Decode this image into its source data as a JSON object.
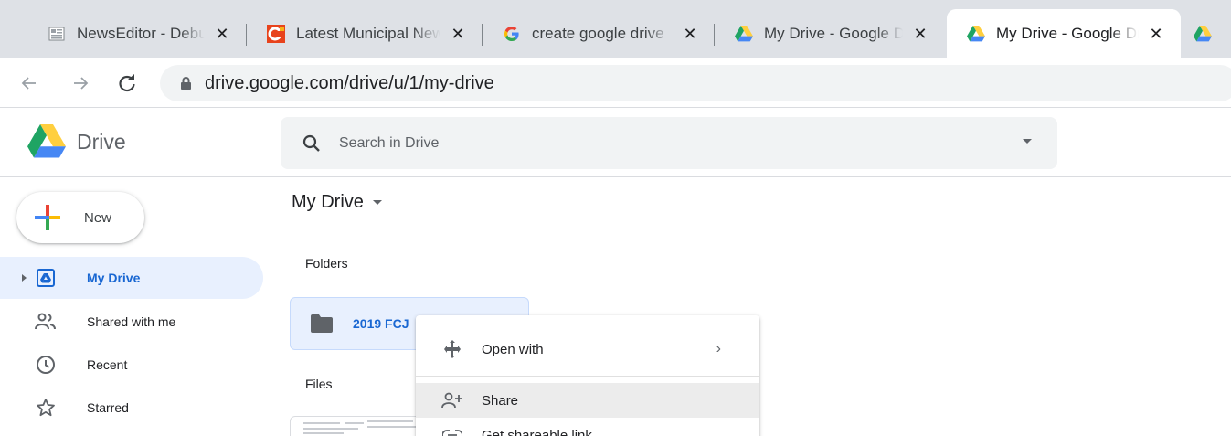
{
  "browser": {
    "tabs": [
      {
        "title": "NewsEditor - Debug",
        "favicon": "page-icon"
      },
      {
        "title": "Latest Municipal News",
        "favicon": "news-logo-icon"
      },
      {
        "title": "create google drive",
        "favicon": "google-g-icon"
      },
      {
        "title": "My Drive - Google Drive",
        "favicon": "drive-icon"
      },
      {
        "title": "My Drive - Google Drive",
        "favicon": "drive-icon",
        "active": true
      }
    ],
    "url": "drive.google.com/drive/u/1/my-drive"
  },
  "drive": {
    "app_name": "Drive",
    "search_placeholder": "Search in Drive"
  },
  "sidebar": {
    "new_label": "New",
    "items": [
      {
        "label": "My Drive",
        "icon": "my-drive-icon",
        "active": true
      },
      {
        "label": "Shared with me",
        "icon": "people-icon"
      },
      {
        "label": "Recent",
        "icon": "clock-icon"
      },
      {
        "label": "Starred",
        "icon": "star-icon"
      }
    ]
  },
  "main": {
    "breadcrumb": "My Drive",
    "folders_heading": "Folders",
    "files_heading": "Files",
    "folders": [
      {
        "name": "2019 FCJ"
      }
    ]
  },
  "context_menu": {
    "items": [
      {
        "label": "Open with",
        "icon": "move-arrows-icon",
        "submenu": true
      },
      {
        "label": "Share",
        "icon": "person-add-icon",
        "highlighted": true
      },
      {
        "label": "Get shareable link",
        "icon": "link-icon"
      }
    ]
  },
  "colors": {
    "accent": "#1967d2",
    "selection_bg": "#e8f0fe",
    "tabstrip_bg": "#dee1e6"
  }
}
